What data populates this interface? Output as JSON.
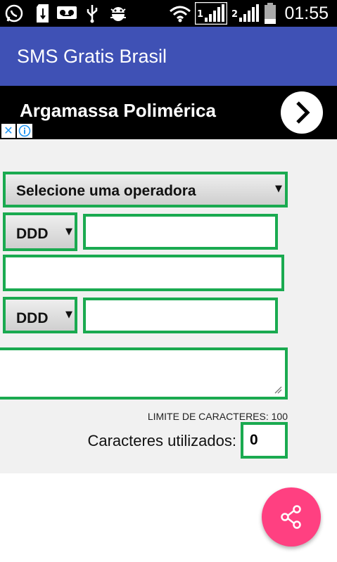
{
  "status_bar": {
    "time": "01:55",
    "sim1_label": "1",
    "sim2_label": "2",
    "icons": [
      "whatsapp-icon",
      "sd-card-icon",
      "voicemail-icon",
      "usb-icon",
      "android-debug-icon",
      "wifi-icon",
      "signal-sim1-icon",
      "signal-sim2-icon",
      "battery-icon"
    ]
  },
  "app_bar": {
    "title": "SMS Gratis Brasil",
    "color": "#3F51B5"
  },
  "ad": {
    "headline": "Argamassa Polimérica",
    "close_glyph": "✕",
    "icons": [
      "ad-close-icon",
      "ad-info-icon",
      "chevron-right-icon"
    ]
  },
  "form": {
    "operator_select": {
      "selected": "Selecione uma operadora"
    },
    "ddd_select_1": {
      "selected": "DDD"
    },
    "phone_input_1": {
      "value": ""
    },
    "wide_input": {
      "value": ""
    },
    "ddd_select_2": {
      "selected": "DDD"
    },
    "phone_input_2": {
      "value": ""
    },
    "message_textarea": {
      "value": ""
    },
    "limit_text": "LIMITE DE CARACTERES: 100",
    "chars_used_label": "Caracteres utilizados:",
    "chars_used_value": "0",
    "border_color": "#1aaa50"
  },
  "fab": {
    "icon": "share-icon",
    "color": "#FF4081"
  }
}
